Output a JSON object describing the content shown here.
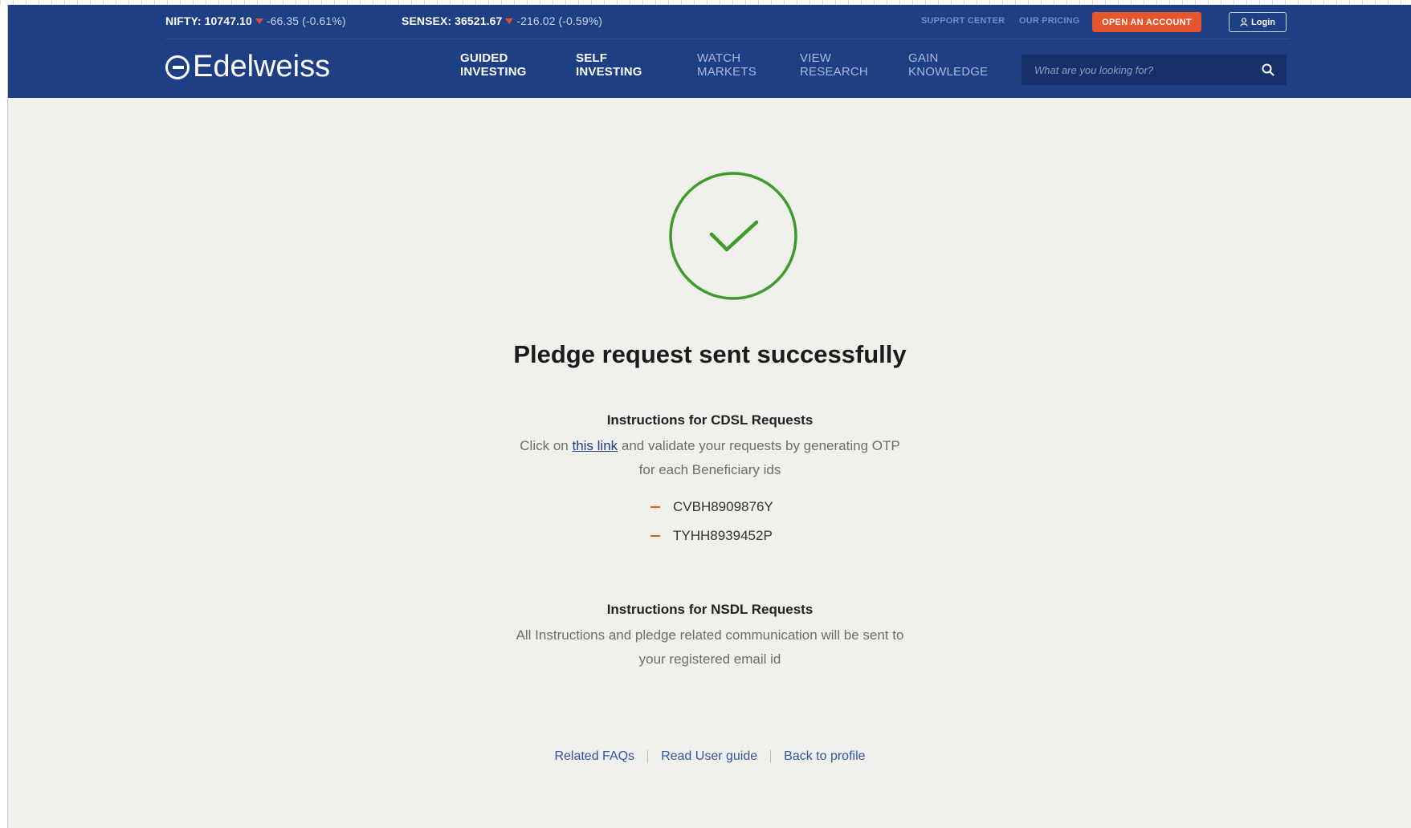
{
  "ticker": {
    "nifty_label": "NIFTY: 10747.10",
    "nifty_change": "-66.35 (-0.61%)",
    "sensex_label": "SENSEX: 36521.67",
    "sensex_change": "-216.02 (-0.59%)"
  },
  "top_links": {
    "support": "SUPPORT CENTER",
    "pricing": "OUR PRICING",
    "open_account": "OPEN AN ACCOUNT",
    "login": "Login"
  },
  "brand": {
    "name": "Edelweiss"
  },
  "nav": [
    {
      "line1": "GUIDED",
      "line2": "INVESTING"
    },
    {
      "line1": "SELF",
      "line2": "INVESTING"
    },
    {
      "line1": "WATCH",
      "line2": "MARKETS"
    },
    {
      "line1": "VIEW",
      "line2": "RESEARCH"
    },
    {
      "line1": "GAIN",
      "line2": "KNOWLEDGE"
    }
  ],
  "search": {
    "placeholder": "What are you looking for?"
  },
  "content": {
    "title": "Pledge request sent successfully",
    "cdsl_heading": "Instructions for CDSL Requests",
    "cdsl_text_before": "Click on ",
    "cdsl_link": "this link",
    "cdsl_text_after": " and validate your requests by generating OTP",
    "cdsl_text_line2": "for each Beneficiary ids",
    "beneficiary_ids": [
      "CVBH8909876Y",
      "TYHH8939452P"
    ],
    "nsdl_heading": "Instructions for NSDL Requests",
    "nsdl_line1": "All Instructions and pledge related communication will be sent to",
    "nsdl_line2": "your registered email id"
  },
  "footer": {
    "faqs": "Related FAQs",
    "guide": "Read User guide",
    "profile": "Back to profile"
  },
  "colors": {
    "header_bg": "#1f3f85",
    "accent_orange": "#e5562c",
    "success_green": "#3f9b2a",
    "link_blue": "#2f54a8"
  }
}
